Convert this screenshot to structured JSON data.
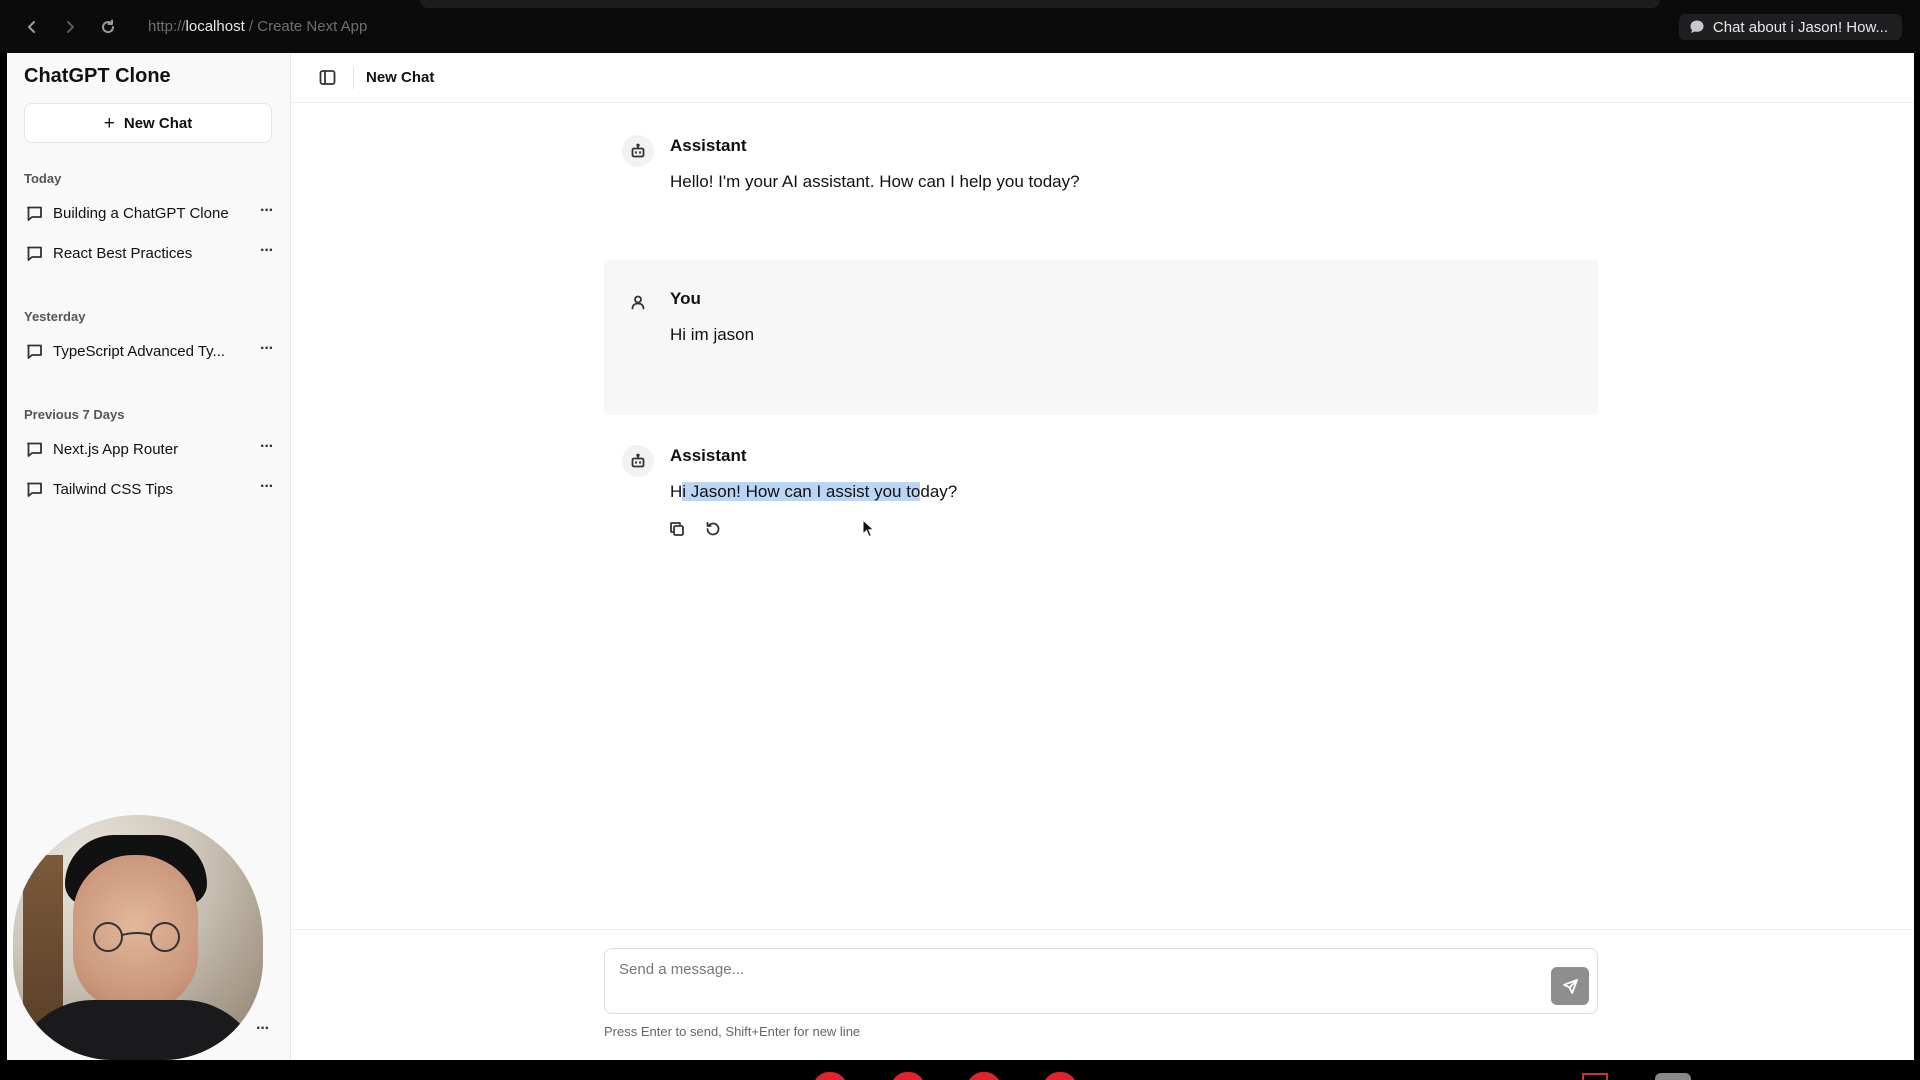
{
  "browser": {
    "url_scheme": "http://",
    "url_host": "localhost",
    "url_rest": " / Create Next App",
    "tab_title": "Chat about i Jason! How..."
  },
  "sidebar": {
    "title": "ChatGPT Clone",
    "new_chat_label": "New Chat",
    "sections": [
      {
        "label": "Today",
        "items": [
          "Building a ChatGPT Clone",
          "React Best Practices"
        ]
      },
      {
        "label": "Yesterday",
        "items": [
          "TypeScript Advanced Ty..."
        ]
      },
      {
        "label": "Previous 7 Days",
        "items": [
          "Next.js App Router",
          "Tailwind CSS Tips"
        ]
      }
    ]
  },
  "header": {
    "title": "New Chat"
  },
  "messages": [
    {
      "role": "assistant",
      "sender": "Assistant",
      "text": "Hello! I'm your AI assistant. How can I help you today?"
    },
    {
      "role": "user",
      "sender": "You",
      "text": "Hi im jason"
    },
    {
      "role": "assistant",
      "sender": "Assistant",
      "text_before": "H",
      "text_selected": "i Jason! How can I assist you to",
      "text_after": "day?"
    }
  ],
  "composer": {
    "placeholder": "Send a message...",
    "hint": "Press Enter to send, Shift+Enter for new line"
  },
  "colors": {
    "selection": "#bcd5f5",
    "send_button": "#8e8e8e",
    "sidebar_bg": "#f9f9f9"
  }
}
